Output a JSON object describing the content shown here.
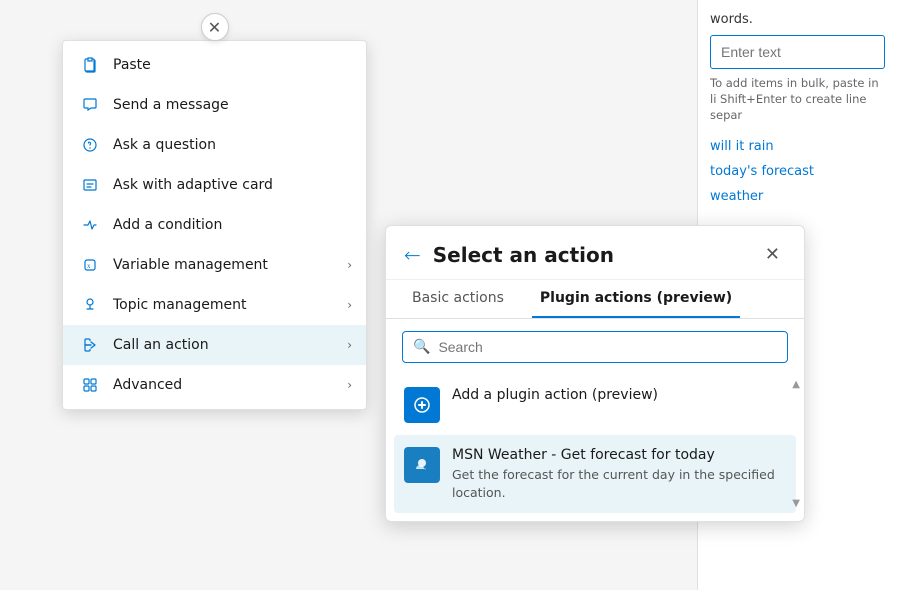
{
  "background": {
    "words_label": "words.",
    "enter_text_placeholder": "Enter text",
    "hint_text": "To add items in bulk, paste in li Shift+Enter to create line separ",
    "tag1": "will it rain",
    "tag2": "today's forecast",
    "tag3": "weather"
  },
  "close_button": {
    "symbol": "✕"
  },
  "context_menu": {
    "items": [
      {
        "id": "paste",
        "label": "Paste",
        "icon": "paste",
        "has_chevron": false
      },
      {
        "id": "send-message",
        "label": "Send a message",
        "icon": "message",
        "has_chevron": false
      },
      {
        "id": "ask-question",
        "label": "Ask a question",
        "icon": "question",
        "has_chevron": false
      },
      {
        "id": "ask-adaptive",
        "label": "Ask with adaptive card",
        "icon": "adaptive",
        "has_chevron": false
      },
      {
        "id": "add-condition",
        "label": "Add a condition",
        "icon": "condition",
        "has_chevron": false
      },
      {
        "id": "variable-mgmt",
        "label": "Variable management",
        "icon": "variable",
        "has_chevron": true
      },
      {
        "id": "topic-mgmt",
        "label": "Topic management",
        "icon": "topic",
        "has_chevron": true
      },
      {
        "id": "call-action",
        "label": "Call an action",
        "icon": "action",
        "has_chevron": true,
        "active": true
      },
      {
        "id": "advanced",
        "label": "Advanced",
        "icon": "advanced",
        "has_chevron": true
      }
    ]
  },
  "action_panel": {
    "title": "Select an action",
    "back_label": "←",
    "close_label": "✕",
    "tabs": [
      {
        "id": "basic",
        "label": "Basic actions",
        "active": false
      },
      {
        "id": "plugin",
        "label": "Plugin actions (preview)",
        "active": true
      }
    ],
    "search_placeholder": "Search",
    "actions": [
      {
        "id": "add-plugin",
        "icon": "plugin",
        "title": "Add a plugin action (preview)",
        "description": ""
      },
      {
        "id": "msn-weather",
        "icon": "weather",
        "title": "MSN Weather - Get forecast for today",
        "description": "Get the forecast for the current day in the specified location."
      }
    ]
  }
}
